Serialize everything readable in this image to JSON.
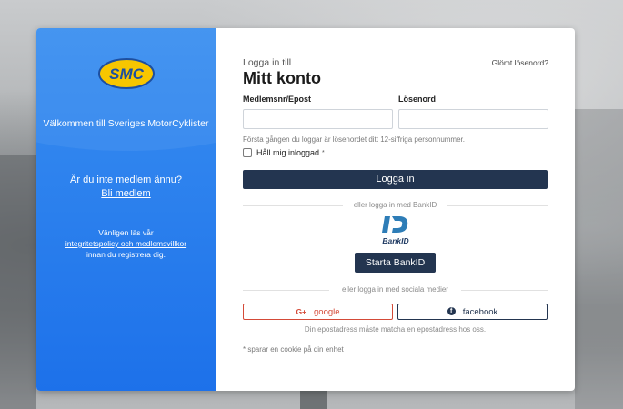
{
  "left": {
    "welcome": "Välkommen till Sveriges MotorCyklister",
    "not_member": "Är du inte medlem ännu?",
    "join_link": "Bli medlem",
    "read_prefix": "Vänligen läs vår",
    "policy_link": "integritetspolicy och medlemsvillkor",
    "read_suffix": "innan du registrera dig."
  },
  "logo": {
    "text": "SMC",
    "colors": {
      "fill": "#f7c600",
      "text": "#1d4fa0"
    }
  },
  "form": {
    "subtitle": "Logga in till",
    "title": "Mitt konto",
    "forgot": "Glömt lösenord?",
    "member_label": "Medlemsnr/Epost",
    "member_value": "",
    "password_label": "Lösenord",
    "password_value": "",
    "hint": "Första gången du loggar är lösenordet ditt 12-siffriga personnummer.",
    "remember_label": "Håll mig inloggad",
    "remember_mark": "*",
    "remember_checked": false,
    "login_button": "Logga in",
    "bankid_divider": "eller logga in med BankID",
    "bankid_logo_text": "BankID",
    "bankid_button": "Starta BankID",
    "social_divider": "eller logga in med sociala medier",
    "google_icon": "G+",
    "google_button": "google",
    "facebook_icon": "f",
    "facebook_button": "facebook",
    "email_note": "Din epostadress måste matcha en epostadress hos oss.",
    "cookie_note": "* sparar en cookie på din enhet"
  },
  "colors": {
    "panel_blue": "#2f84ee",
    "primary_button": "#233550",
    "google_red": "#d44a38",
    "bankid_blue": "#2e7db7"
  }
}
